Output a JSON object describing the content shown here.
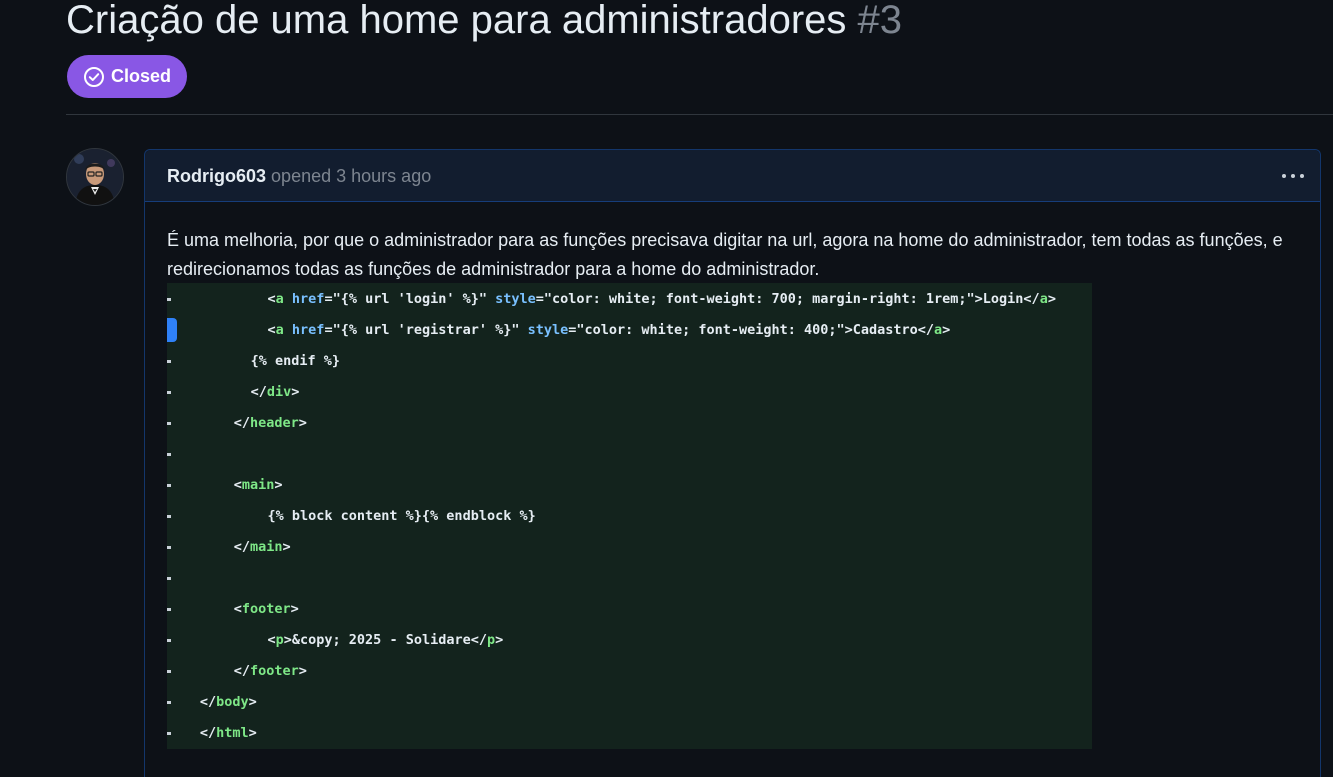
{
  "issue": {
    "title": "Criação de uma home para administradores",
    "number": "#3",
    "state": "Closed",
    "state_icon": "circle-check-icon",
    "state_color": "#8957e5"
  },
  "comment": {
    "author": "Rodrigo603",
    "action": "opened",
    "time": "3 hours ago",
    "menu_icon": "kebab-horizontal-icon",
    "body": "É uma melhoria, por que o administrador para as funções precisava digitar na url, agora na home do administrador, tem todas as funções, e redirecionamos todas as funções de administrador para a home do administrador."
  },
  "code_image": {
    "background": "#13231d",
    "lines": [
      {
        "indent": 10,
        "active": false,
        "parts": [
          {
            "t": "<",
            "c": "p"
          },
          {
            "t": "a",
            "c": "tag"
          },
          {
            "t": " ",
            "c": "p"
          },
          {
            "t": "href",
            "c": "attr"
          },
          {
            "t": "=\"{% url 'login' %}\" ",
            "c": "str"
          },
          {
            "t": "style",
            "c": "attr"
          },
          {
            "t": "=\"color: white; font-weight: 700; margin-right: 1rem;\">Login</",
            "c": "str"
          },
          {
            "t": "a",
            "c": "tag"
          },
          {
            "t": ">",
            "c": "p"
          }
        ]
      },
      {
        "indent": 10,
        "active": true,
        "parts": [
          {
            "t": "<",
            "c": "p"
          },
          {
            "t": "a",
            "c": "tag"
          },
          {
            "t": " ",
            "c": "p"
          },
          {
            "t": "href",
            "c": "attr"
          },
          {
            "t": "=\"{% url 'registrar' %}\" ",
            "c": "str"
          },
          {
            "t": "style",
            "c": "attr"
          },
          {
            "t": "=\"color: white; font-weight: 400;\">Cadastro</",
            "c": "str"
          },
          {
            "t": "a",
            "c": "tag"
          },
          {
            "t": ">",
            "c": "p"
          }
        ]
      },
      {
        "indent": 8,
        "active": false,
        "parts": [
          {
            "t": "{% endif %}",
            "c": "p"
          }
        ]
      },
      {
        "indent": 8,
        "active": false,
        "parts": [
          {
            "t": "</",
            "c": "p"
          },
          {
            "t": "div",
            "c": "tag"
          },
          {
            "t": ">",
            "c": "p"
          }
        ]
      },
      {
        "indent": 6,
        "active": false,
        "parts": [
          {
            "t": "</",
            "c": "p"
          },
          {
            "t": "header",
            "c": "tag"
          },
          {
            "t": ">",
            "c": "p"
          }
        ]
      },
      {
        "indent": 0,
        "active": false,
        "parts": []
      },
      {
        "indent": 6,
        "active": false,
        "parts": [
          {
            "t": "<",
            "c": "p"
          },
          {
            "t": "main",
            "c": "tag"
          },
          {
            "t": ">",
            "c": "p"
          }
        ]
      },
      {
        "indent": 10,
        "active": false,
        "parts": [
          {
            "t": "{% block content %}{% endblock %}",
            "c": "p"
          }
        ]
      },
      {
        "indent": 6,
        "active": false,
        "parts": [
          {
            "t": "</",
            "c": "p"
          },
          {
            "t": "main",
            "c": "tag"
          },
          {
            "t": ">",
            "c": "p"
          }
        ]
      },
      {
        "indent": 0,
        "active": false,
        "parts": []
      },
      {
        "indent": 6,
        "active": false,
        "parts": [
          {
            "t": "<",
            "c": "p"
          },
          {
            "t": "footer",
            "c": "tag"
          },
          {
            "t": ">",
            "c": "p"
          }
        ]
      },
      {
        "indent": 10,
        "active": false,
        "parts": [
          {
            "t": "<",
            "c": "p"
          },
          {
            "t": "p",
            "c": "tag"
          },
          {
            "t": ">&copy; 2025 - Solidare</",
            "c": "p"
          },
          {
            "t": "p",
            "c": "tag"
          },
          {
            "t": ">",
            "c": "p"
          }
        ]
      },
      {
        "indent": 6,
        "active": false,
        "parts": [
          {
            "t": "</",
            "c": "p"
          },
          {
            "t": "footer",
            "c": "tag"
          },
          {
            "t": ">",
            "c": "p"
          }
        ]
      },
      {
        "indent": 2,
        "active": false,
        "parts": [
          {
            "t": "</",
            "c": "p"
          },
          {
            "t": "body",
            "c": "tag"
          },
          {
            "t": ">",
            "c": "p"
          }
        ]
      },
      {
        "indent": 2,
        "active": false,
        "parts": [
          {
            "t": "</",
            "c": "p"
          },
          {
            "t": "html",
            "c": "tag"
          },
          {
            "t": ">",
            "c": "p"
          }
        ]
      }
    ]
  }
}
